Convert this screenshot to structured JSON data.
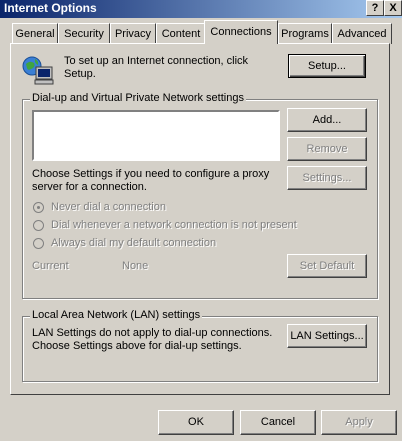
{
  "window": {
    "title": "Internet Options",
    "help_btn": "?",
    "close_btn": "X"
  },
  "tabs": [
    {
      "label": "General"
    },
    {
      "label": "Security"
    },
    {
      "label": "Privacy"
    },
    {
      "label": "Content"
    },
    {
      "label": "Connections"
    },
    {
      "label": "Programs"
    },
    {
      "label": "Advanced"
    }
  ],
  "setup": {
    "text": "To set up an Internet connection, click Setup.",
    "button": "Setup..."
  },
  "dialup": {
    "legend": "Dial-up and Virtual Private Network settings",
    "add": "Add...",
    "remove": "Remove",
    "settings": "Settings...",
    "proxy_text": "Choose Settings if you need to configure a proxy server for a connection.",
    "radios": [
      {
        "label": "Never dial a connection",
        "selected": true
      },
      {
        "label": "Dial whenever a network connection is not present",
        "selected": false
      },
      {
        "label": "Always dial my default connection",
        "selected": false
      }
    ],
    "current_label": "Current",
    "current_value": "None",
    "set_default": "Set Default"
  },
  "lan": {
    "legend": "Local Area Network (LAN) settings",
    "text": "LAN Settings do not apply to dial-up connections. Choose Settings above for dial-up settings.",
    "button": "LAN Settings..."
  },
  "footer": {
    "ok": "OK",
    "cancel": "Cancel",
    "apply": "Apply"
  }
}
